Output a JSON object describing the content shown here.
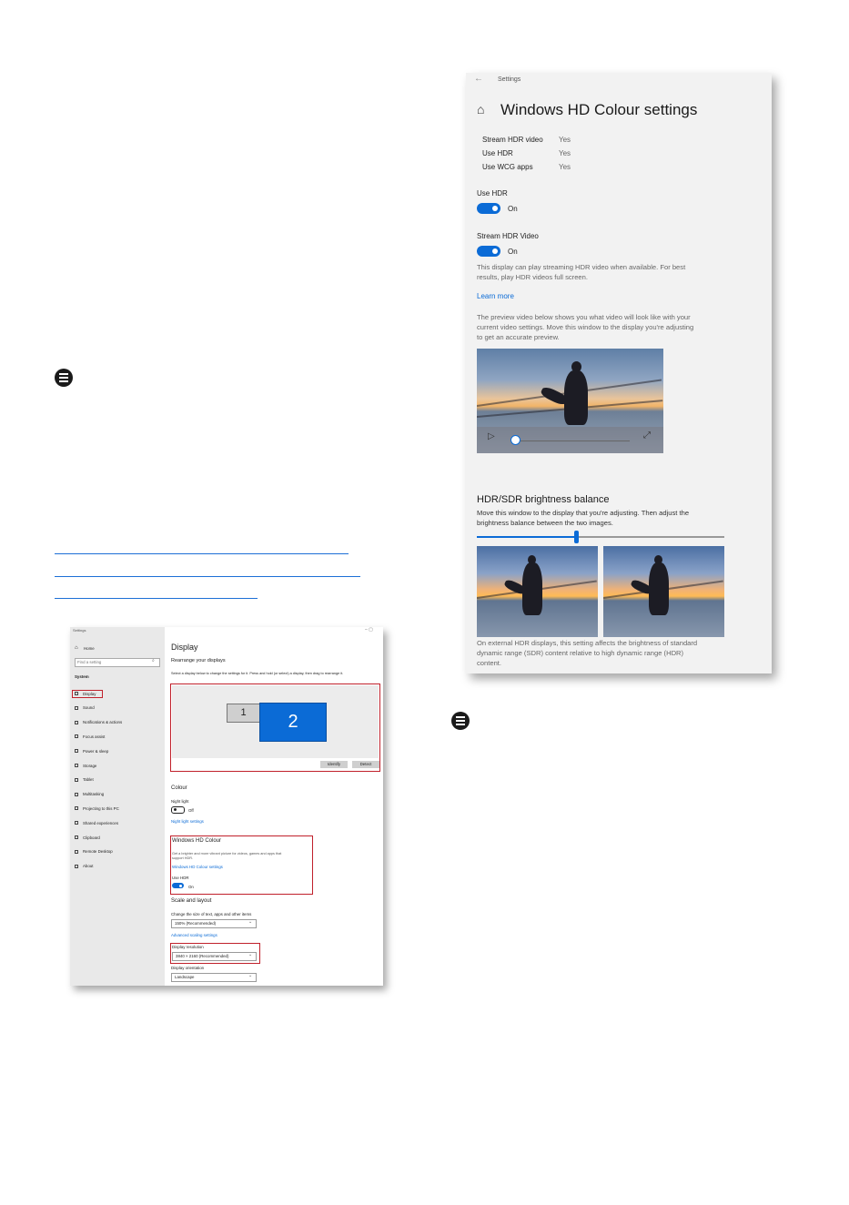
{
  "hd_colour": {
    "back_label": "Settings",
    "title": "Windows HD Colour settings",
    "capabilities": [
      {
        "label": "Stream HDR video",
        "value": "Yes"
      },
      {
        "label": "Use HDR",
        "value": "Yes"
      },
      {
        "label": "Use WCG apps",
        "value": "Yes"
      }
    ],
    "use_hdr": {
      "label": "Use HDR",
      "state": "On"
    },
    "stream_hdr": {
      "label": "Stream HDR Video",
      "state": "On",
      "desc_line1": "This display can play streaming HDR video when available. For best",
      "desc_line2": "results, play HDR videos full screen."
    },
    "learn_more": "Learn more",
    "preview_line1": "The preview video below shows you what video will look like with your",
    "preview_line2": "current video settings. Move this window to the display you're adjusting",
    "preview_line3": "to get an accurate preview.",
    "video_progress": 0.0,
    "balance_title": "HDR/SDR brightness balance",
    "balance_line1": "Move this window to the display that you're adjusting. Then adjust the",
    "balance_line2": "brightness balance between the two images.",
    "balance_value": 0.41,
    "footer_line1": "On external HDR displays, this setting affects the brightness of standard",
    "footer_line2": "dynamic range (SDR) content relative to high dynamic range (HDR)",
    "footer_line3": "content."
  },
  "settings_window": {
    "title": "Settings",
    "sidebar": {
      "home": "Home",
      "search_placeholder": "Find a setting",
      "section": "System",
      "items": [
        "Display",
        "Sound",
        "Notifications & actions",
        "Focus assist",
        "Power & sleep",
        "Storage",
        "Tablet",
        "Multitasking",
        "Projecting to this PC",
        "Shared experiences",
        "Clipboard",
        "Remote Desktop",
        "About"
      ]
    },
    "main": {
      "heading": "Display",
      "rearrange_title": "Rearrange your displays",
      "rearrange_desc": "Select a display below to change the settings for it. Press and hold (or select) a display, then drag to rearrange it.",
      "monitor_1": "1",
      "monitor_2": "2",
      "identify_button": "Identify",
      "detect_button": "Detect",
      "colour_title": "Colour",
      "night_light_label": "Night light",
      "night_light_state": "Off",
      "night_light_link": "Night light settings",
      "hd_colour_title": "Windows HD Colour",
      "hd_colour_desc_line1": "Get a brighter and more vibrant picture for videos, games and apps that",
      "hd_colour_desc_line2": "support HDR.",
      "hd_colour_link": "Windows HD Colour settings",
      "use_hdr_label": "Use HDR",
      "use_hdr_state": "On",
      "scale_title": "Scale and layout",
      "scale_desc": "Change the size of text, apps and other items",
      "scale_value": "150% (Recommended)",
      "advanced_scaling_link": "Advanced scaling settings",
      "resolution_label": "Display resolution",
      "resolution_value": "3840 × 2160 (Recommended)",
      "orientation_label": "Display orientation",
      "orientation_value": "Landscape"
    }
  },
  "colors": {
    "accent": "#0b6bd6",
    "highlight_red": "#c0202b",
    "monitor_selected": "#0b6bd6"
  }
}
